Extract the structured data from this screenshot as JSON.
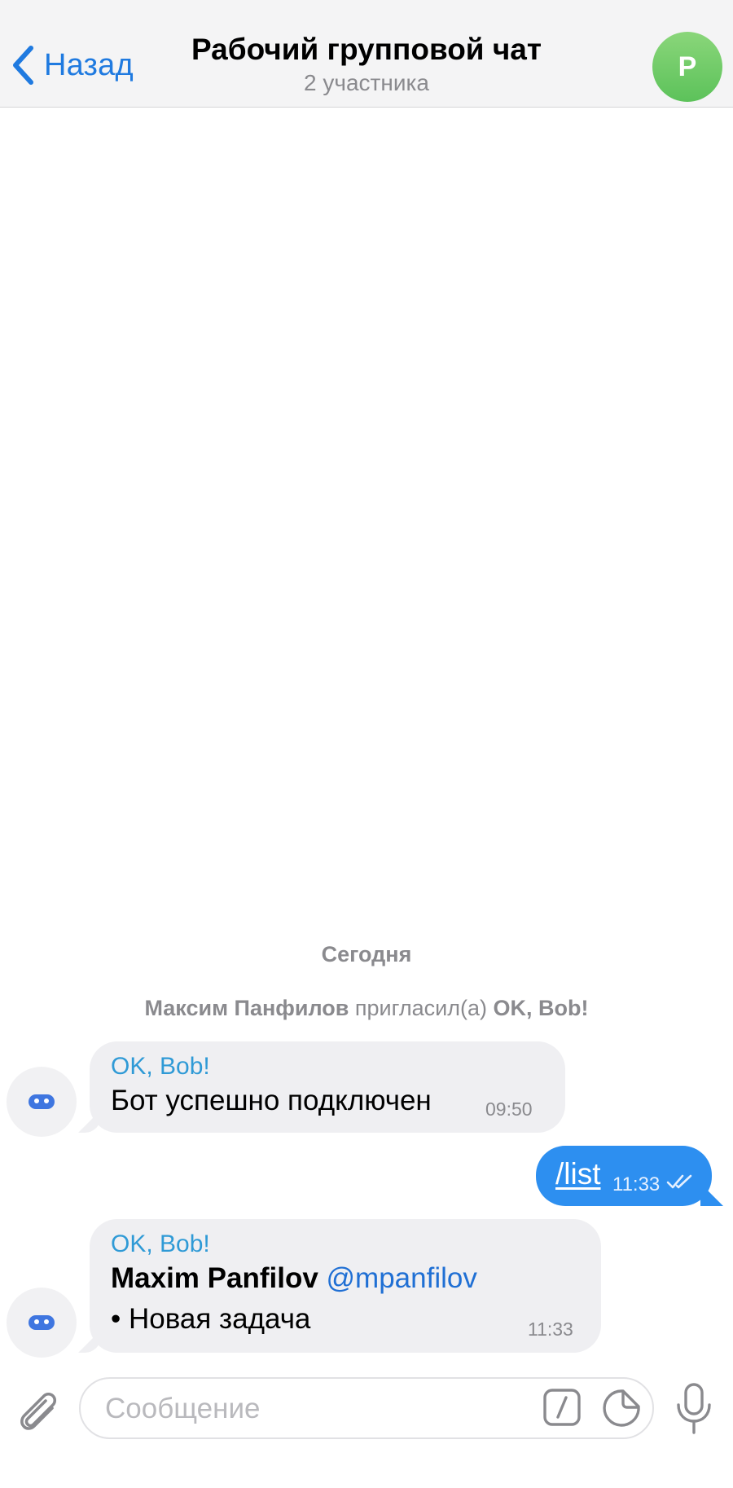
{
  "header": {
    "back_label": "Назад",
    "title": "Рабочий групповой чат",
    "subtitle": "2 участника",
    "avatar_letter": "P",
    "accent_color": "#1f7ae0"
  },
  "chat": {
    "date_label": "Сегодня",
    "service": {
      "actor": "Максим Панфилов",
      "action": "пригласил(а)",
      "target": "OK, Bob!"
    },
    "messages": [
      {
        "sender": "OK, Bob!",
        "text": "Бот успешно подключен",
        "time": "09:50"
      },
      {
        "text": "/list",
        "time": "11:33",
        "status": "read"
      },
      {
        "sender": "OK, Bob!",
        "name": "Maxim Panfilov",
        "mention": "@mpanfilov",
        "item": "• Новая задача",
        "time": "11:33"
      }
    ]
  },
  "composer": {
    "placeholder": "Сообщение",
    "icons": [
      "paperclip-icon",
      "slash-command-icon",
      "sticker-icon",
      "microphone-icon"
    ]
  }
}
